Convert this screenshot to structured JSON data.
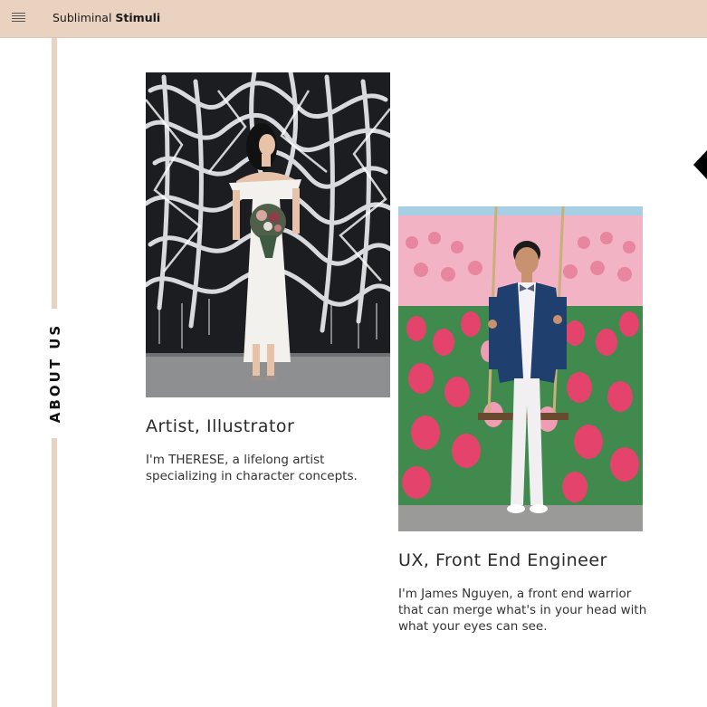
{
  "header": {
    "menu_icon": "hamburger-menu-icon",
    "brand_light": "Subliminal ",
    "brand_bold": "Stimuli",
    "background": "#ead2c1"
  },
  "sidebar": {
    "section_label": "ABOUT US",
    "accent": "#ead2c1"
  },
  "nav": {
    "arrow_icon": "chevron-left-icon"
  },
  "team": [
    {
      "photo_alt": "Woman in white dress holding bouquet before a graffiti wall",
      "role": "Artist, Illustrator",
      "bio": "I'm THERESE, a lifelong artist specializing in character concepts."
    },
    {
      "photo_alt": "Man in blue blazer on a swing in front of a tulip mural",
      "role": "UX, Front End Engineer",
      "bio": "I'm James Nguyen, a front end warrior that can merge what's in your head with what your eyes can see."
    }
  ]
}
